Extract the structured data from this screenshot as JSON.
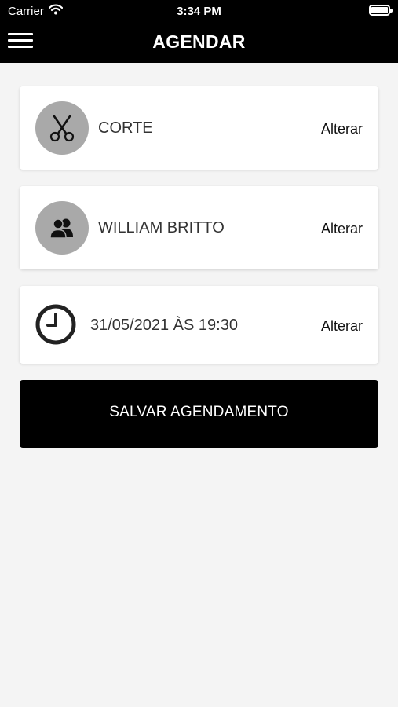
{
  "status_bar": {
    "carrier": "Carrier",
    "time": "3:34 PM"
  },
  "header": {
    "title": "AGENDAR",
    "menu_icon": "hamburger-menu-icon"
  },
  "cards": [
    {
      "icon": "scissors-icon",
      "label": "CORTE",
      "action": "Alterar"
    },
    {
      "icon": "users-icon",
      "label": "WILLIAM BRITTO",
      "action": "Alterar"
    },
    {
      "icon": "clock-icon",
      "label": "31/05/2021 ÀS 19:30",
      "action": "Alterar"
    }
  ],
  "save_button": {
    "label": "SALVAR AGENDAMENTO"
  },
  "colors": {
    "header_bg": "#000000",
    "page_bg": "#f4f4f4",
    "icon_circle": "#a9a9a9",
    "button_bg": "#000000"
  }
}
